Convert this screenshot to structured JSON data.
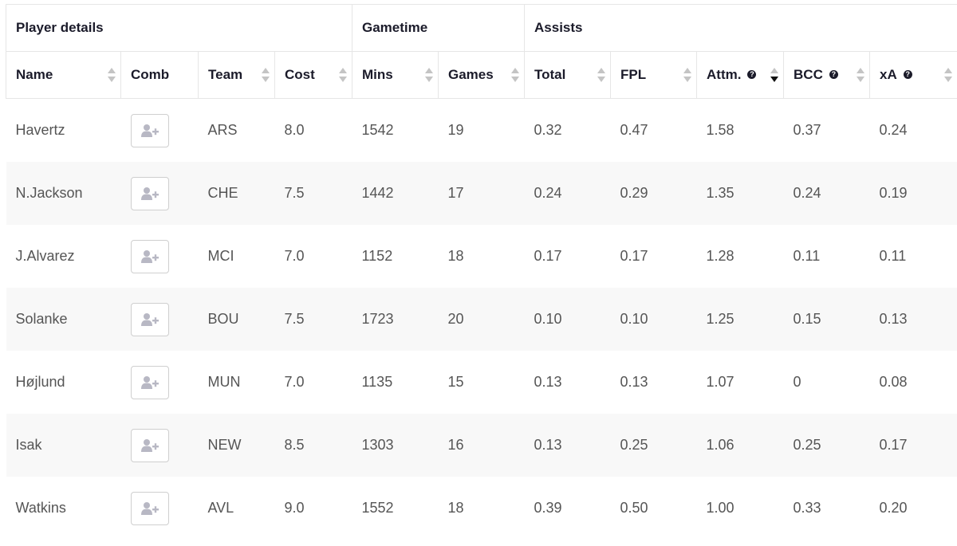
{
  "table": {
    "groups": [
      {
        "label": "Player details",
        "span": 4
      },
      {
        "label": "Gametime",
        "span": 2
      },
      {
        "label": "Assists",
        "span": 5
      }
    ],
    "columns": [
      {
        "key": "name",
        "label": "Name",
        "sortable": true,
        "help": false
      },
      {
        "key": "comb",
        "label": "Comb",
        "sortable": false,
        "help": false
      },
      {
        "key": "team",
        "label": "Team",
        "sortable": true,
        "help": false
      },
      {
        "key": "cost",
        "label": "Cost",
        "sortable": true,
        "help": false
      },
      {
        "key": "mins",
        "label": "Mins",
        "sortable": true,
        "help": false
      },
      {
        "key": "games",
        "label": "Games",
        "sortable": true,
        "help": false
      },
      {
        "key": "total",
        "label": "Total",
        "sortable": true,
        "help": false
      },
      {
        "key": "fpl",
        "label": "FPL",
        "sortable": true,
        "help": false
      },
      {
        "key": "attm",
        "label": "Attm.",
        "sortable": true,
        "help": true,
        "sorted": "desc"
      },
      {
        "key": "bcc",
        "label": "BCC",
        "sortable": true,
        "help": true
      },
      {
        "key": "xa",
        "label": "xA",
        "sortable": true,
        "help": true
      }
    ],
    "help_glyph": "?",
    "comb_icon": "user-plus-icon",
    "rows": [
      {
        "name": "Havertz",
        "team": "ARS",
        "cost": "8.0",
        "mins": "1542",
        "games": "19",
        "total": "0.32",
        "fpl": "0.47",
        "attm": "1.58",
        "bcc": "0.37",
        "xa": "0.24"
      },
      {
        "name": "N.Jackson",
        "team": "CHE",
        "cost": "7.5",
        "mins": "1442",
        "games": "17",
        "total": "0.24",
        "fpl": "0.29",
        "attm": "1.35",
        "bcc": "0.24",
        "xa": "0.19"
      },
      {
        "name": "J.Alvarez",
        "team": "MCI",
        "cost": "7.0",
        "mins": "1152",
        "games": "18",
        "total": "0.17",
        "fpl": "0.17",
        "attm": "1.28",
        "bcc": "0.11",
        "xa": "0.11"
      },
      {
        "name": "Solanke",
        "team": "BOU",
        "cost": "7.5",
        "mins": "1723",
        "games": "20",
        "total": "0.10",
        "fpl": "0.10",
        "attm": "1.25",
        "bcc": "0.15",
        "xa": "0.13"
      },
      {
        "name": "Højlund",
        "team": "MUN",
        "cost": "7.0",
        "mins": "1135",
        "games": "15",
        "total": "0.13",
        "fpl": "0.13",
        "attm": "1.07",
        "bcc": "0",
        "xa": "0.08"
      },
      {
        "name": "Isak",
        "team": "NEW",
        "cost": "8.5",
        "mins": "1303",
        "games": "16",
        "total": "0.13",
        "fpl": "0.25",
        "attm": "1.06",
        "bcc": "0.25",
        "xa": "0.17"
      },
      {
        "name": "Watkins",
        "team": "AVL",
        "cost": "9.0",
        "mins": "1552",
        "games": "18",
        "total": "0.39",
        "fpl": "0.50",
        "attm": "1.00",
        "bcc": "0.33",
        "xa": "0.20"
      }
    ]
  },
  "colors": {
    "header_text": "#1b1b2a",
    "cell_text": "#555555",
    "row_alt_bg": "#f8f8f8",
    "border": "#e6e6e6",
    "sort_inactive": "#c4c4c4",
    "sort_active": "#111111",
    "icon_gray": "#b8b8c4"
  }
}
